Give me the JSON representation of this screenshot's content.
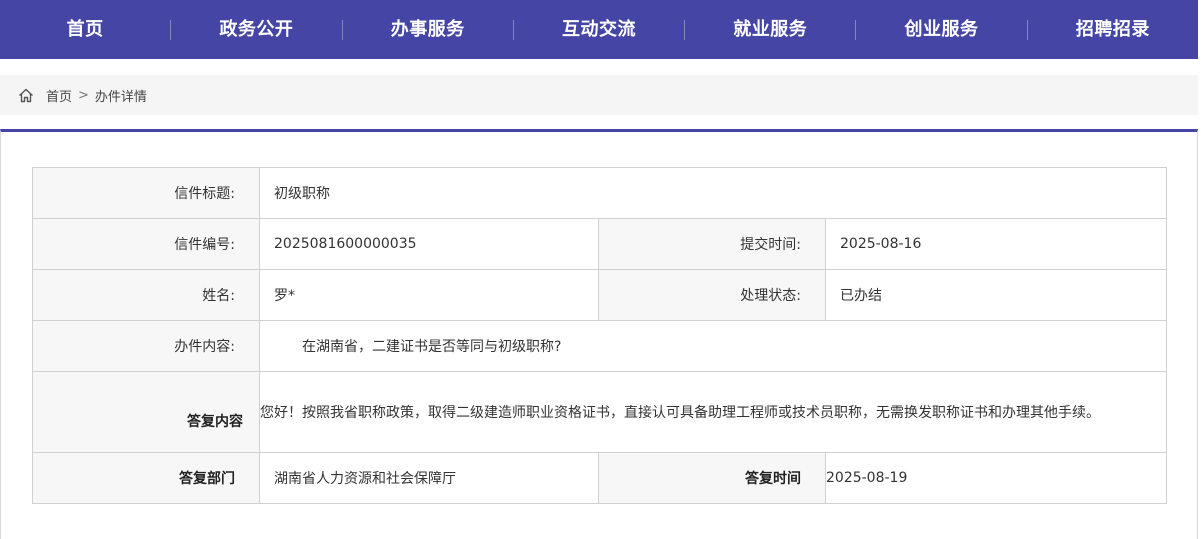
{
  "nav": {
    "items": [
      "首页",
      "政务公开",
      "办事服务",
      "互动交流",
      "就业服务",
      "创业服务",
      "招聘招录"
    ]
  },
  "breadcrumb": {
    "home": "首页",
    "separator": ">",
    "current": "办件详情"
  },
  "detail": {
    "title_label": "信件标题:",
    "title_value": "初级职称",
    "number_label": "信件编号:",
    "number_value": "2025081600000035",
    "submit_time_label": "提交时间:",
    "submit_time_value": "2025-08-16",
    "name_label": "姓名:",
    "name_value": "罗*",
    "status_label": "处理状态:",
    "status_value": "已办结",
    "content_label": "办件内容:",
    "content_value": "在湖南省，二建证书是否等同与初级职称?",
    "reply_label": "答复内容",
    "reply_value": "您好！按照我省职称政策，取得二级建造师职业资格证书，直接认可具备助理工程师或技术员职称，无需换发职称证书和办理其他手续。",
    "dept_label": "答复部门",
    "dept_value": "湖南省人力资源和社会保障厅",
    "reply_time_label": "答复时间",
    "reply_time_value": "2025-08-19"
  },
  "colors": {
    "nav_bg": "#4545a6",
    "accent": "#4545a6",
    "label_bg": "#f7f7f7",
    "border": "#d0d0d0"
  }
}
